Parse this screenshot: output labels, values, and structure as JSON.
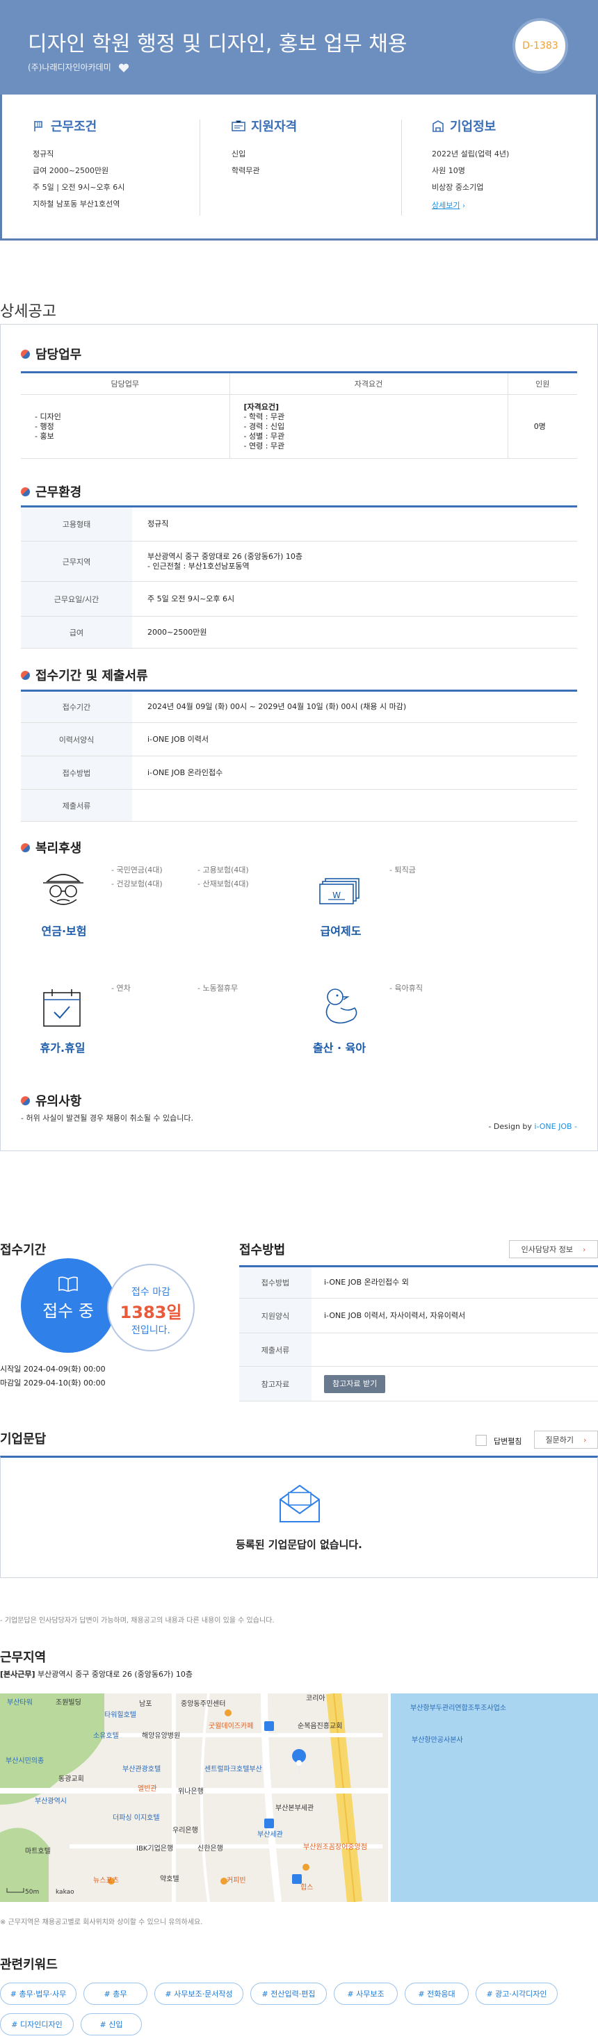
{
  "header": {
    "title": "디자인 학원 행정 및 디자인, 홍보 업무 채용",
    "company": "(주)나래디자인아카데미",
    "dday": "D-1383"
  },
  "conditions": {
    "title": "근무조건",
    "items": [
      "정규직",
      "급여 2000~2500만원",
      "주 5일 | 오전 9시~오후 6시",
      "지하철 남포동 부산1호선역"
    ]
  },
  "qualifications": {
    "title": "지원자격",
    "items": [
      "신입",
      "학력무관"
    ]
  },
  "company_info": {
    "title": "기업정보",
    "items": [
      "2022년 설립(업력 4년)",
      "사원 10명",
      "비상장 중소기업"
    ],
    "link": "상세보기"
  },
  "detail": {
    "section_title": "상세공고",
    "duty": {
      "title": "담당업무",
      "headers": [
        "담당업무",
        "자격요건",
        "인원"
      ],
      "duty_lines": [
        "- 디자인",
        "- 행정",
        "- 홍보"
      ],
      "req_title": "[자격요건]",
      "req_lines": [
        "- 학력 : 무관",
        "- 경력 : 신입",
        "- 성별 : 무관",
        "- 연령 : 무관"
      ],
      "count": "0명"
    },
    "env": {
      "title": "근무환경",
      "rows": [
        {
          "k": "고용형태",
          "v": "정규직",
          "v2": ""
        },
        {
          "k": "근무지역",
          "v": "부산광역시 중구 중앙대로 26 (중앙동6가) 10층",
          "v2": "- 인근전철 : 부산1호선남포동역"
        },
        {
          "k": "근무요일/시간",
          "v": "주 5일 오전 9시~오후 6시",
          "v2": ""
        },
        {
          "k": "급여",
          "v": "2000~2500만원",
          "v2": ""
        }
      ]
    },
    "period": {
      "title": "접수기간 및 제출서류",
      "rows": [
        {
          "k": "접수기간",
          "v": "2024년 04월 09일 (화) 00시 ~ 2029년 04월 10일 (화) 00시 (채용 시 마감)"
        },
        {
          "k": "이력서양식",
          "v": "i-ONE JOB 이력서"
        },
        {
          "k": "접수방법",
          "v": "i-ONE JOB 온라인접수"
        },
        {
          "k": "제출서류",
          "v": ""
        }
      ]
    },
    "welfare": {
      "title": "복리후생",
      "groups": [
        {
          "label": "연금·보험",
          "items1": [
            "- 국민연금(4대)",
            "- 건강보험(4대)"
          ],
          "items2": [
            "- 고용보험(4대)",
            "- 산재보험(4대)"
          ]
        },
        {
          "label": "급여제도",
          "items1": [
            "- 퇴직금"
          ],
          "items2": []
        },
        {
          "label": "휴가.휴일",
          "items1": [
            "- 연차"
          ],
          "items2": [
            "- 노동절휴무"
          ]
        },
        {
          "label": "출산 · 육아",
          "items1": [
            "- 육아휴직"
          ],
          "items2": []
        }
      ]
    },
    "notice": {
      "title": "유의사항",
      "text": "- 허위 사실이 발견될 경우 채용이 취소될 수 있습니다."
    },
    "design_prefix": "- Design by ",
    "design_brand": "i-ONE JOB -"
  },
  "receipt": {
    "title": "접수기간",
    "status": "접수 중",
    "deadline_label": "접수 마감",
    "days": "1383일",
    "days_suffix": "전입니다.",
    "start": "시작일 2024-04-09(화) 00:00",
    "end": "마감일 2029-04-10(화) 00:00"
  },
  "method": {
    "title": "접수방법",
    "hr_button": "인사담당자 정보",
    "rows": [
      {
        "k": "접수방법",
        "v": "i-ONE JOB 온라인접수 외"
      },
      {
        "k": "지원양식",
        "v": "i-ONE JOB 이력서, 자사이력서, 자유이력서"
      },
      {
        "k": "제출서류",
        "v": ""
      },
      {
        "k": "참고자료",
        "v": ""
      }
    ],
    "ref_button": "참고자료 받기"
  },
  "qa": {
    "title": "기업문답",
    "checkbox_label": "답변펼침",
    "ask_button": "질문하기",
    "empty": "등록된 기업문답이 없습니다.",
    "note": "- 기업문답은 인사담당자가 답변이 가능하며, 채용공고의 내용과 다른 내용이 있을 수 있습니다."
  },
  "location": {
    "title": "근무지역",
    "addr_label": "[본사근무]",
    "addr": "부산광역시 중구 중앙대로 26 (중앙동6가) 10층",
    "map_note": "※ 근무지역은 채용공고별로 회사위치와 상이할 수 있으니 유의하세요.",
    "scale": "50m",
    "map_labels": [
      "부산타워",
      "조원빌딩",
      "타워힐호텔",
      "남포",
      "중앙동주민센터",
      "코리아",
      "순복음진흥교회",
      "부산항부두관리연합조투조사업소",
      "부산항만공사본사",
      "굿윌데이즈카페",
      "소유호텔",
      "해양유양병원",
      "부산관광호텔",
      "센트럴파크호텔부산",
      "엘빈관",
      "위나은행",
      "부산본부세관",
      "부산원조꼼장어중앙점",
      "더파싱 이지호텔",
      "우리은행",
      "부산세관",
      "IBK기업은행",
      "신한은행",
      "마트호텔",
      "약호텔",
      "커피빈",
      "뉴스포츠",
      "힙스",
      "동광교회",
      "부산시민의종",
      "부산광역시"
    ],
    "map_brand": "kakao"
  },
  "keywords": {
    "title": "관련키워드",
    "items": [
      "# 총무·법무·사무",
      "# 총무",
      "# 사무보조·문서작성",
      "# 전산입력·편집",
      "# 사무보조",
      "# 전화응대",
      "# 광고·시각디자인",
      "# 디자인디자인",
      "# 신입"
    ]
  },
  "colors": {
    "header_bg": "#6c8fbf",
    "accent": "#3a6fb8",
    "dday": "#f0a030",
    "receipt_circle": "#2f80e8",
    "days_red": "#e85a3a"
  }
}
